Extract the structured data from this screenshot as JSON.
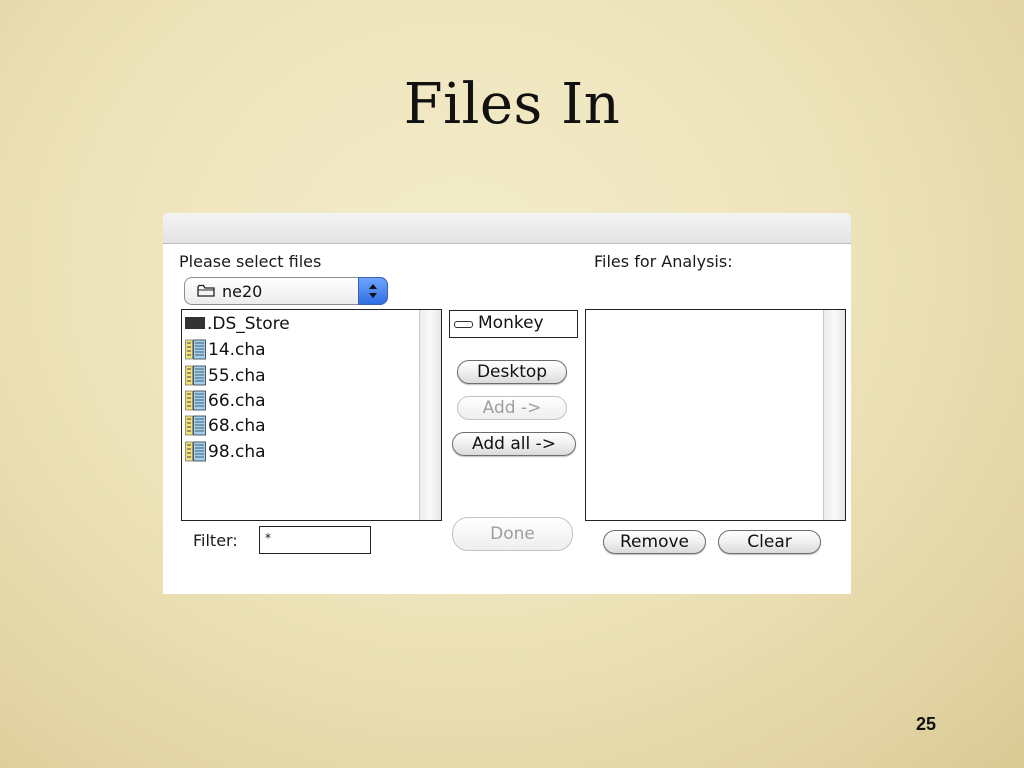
{
  "slide": {
    "title": "Files In",
    "page_number": "25"
  },
  "dialog": {
    "select_label": "Please select files",
    "analysis_label": "Files for Analysis:",
    "folder_popup": {
      "selected": "ne20",
      "icon": "folder-icon"
    },
    "file_list": [
      {
        "name": ".DS_Store",
        "icon": "generic-file-icon"
      },
      {
        "name": "14.cha",
        "icon": "cha-document-icon"
      },
      {
        "name": "55.cha",
        "icon": "cha-document-icon"
      },
      {
        "name": "66.cha",
        "icon": "cha-document-icon"
      },
      {
        "name": "68.cha",
        "icon": "cha-document-icon"
      },
      {
        "name": "98.cha",
        "icon": "cha-document-icon"
      }
    ],
    "volume": {
      "name": "Monkey",
      "icon": "drive-icon"
    },
    "buttons": {
      "desktop": "Desktop",
      "add": "Add ->",
      "add_all": "Add all ->",
      "done": "Done",
      "remove": "Remove",
      "clear": "Clear"
    },
    "filter": {
      "label": "Filter:",
      "value": "*"
    }
  },
  "colors": {
    "popup_accent": "#2f6fe4",
    "disabled_text": "#9e9e9e"
  }
}
